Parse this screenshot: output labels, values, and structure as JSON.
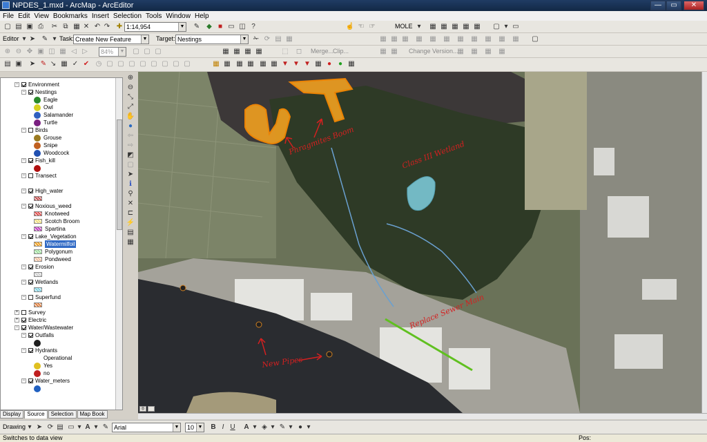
{
  "window": {
    "title": "NPDES_1.mxd - ArcMap - ArcEditor",
    "minimize": "—",
    "maximize": "▭",
    "close": "✕"
  },
  "menu": [
    "File",
    "Edit",
    "View",
    "Bookmarks",
    "Insert",
    "Selection",
    "Tools",
    "Window",
    "Help"
  ],
  "toolbar": {
    "scale_value": "1:14,954",
    "editor_label": "Editor",
    "task_label": "Task:",
    "task_value": "Create New Feature",
    "target_label": "Target:",
    "target_value": "Nestings",
    "zoom_value": "84%",
    "merge_label": "Merge...",
    "clip_label": "Clip...",
    "mole_label": "MOLE",
    "change_version_label": "Change Version..."
  },
  "toc": {
    "rows": [
      {
        "level": 1,
        "label": "Environment",
        "checked": true,
        "expand": "−"
      },
      {
        "level": 2,
        "label": "Nestings",
        "checked": true,
        "expand": "−"
      },
      {
        "level": 3,
        "label": "Eagle",
        "symbol_color": "#2a8a2a"
      },
      {
        "level": 3,
        "label": "Owl",
        "symbol_color": "#d6d020"
      },
      {
        "level": 3,
        "label": "Salamander",
        "symbol_color": "#3060c0"
      },
      {
        "level": 3,
        "label": "Turtle",
        "symbol_color": "#7a2080"
      },
      {
        "level": 2,
        "label": "Birds",
        "checked": false,
        "expand": "−"
      },
      {
        "level": 3,
        "label": "Grouse",
        "symbol_color": "#9a7a20"
      },
      {
        "level": 3,
        "label": "Snipe",
        "symbol_color": "#c06020"
      },
      {
        "level": 3,
        "label": "Woodcock",
        "symbol_color": "#2050b0"
      },
      {
        "level": 2,
        "label": "Fish_kill",
        "checked": true,
        "expand": "−"
      },
      {
        "level": 3,
        "label": "",
        "symbol_color": "#b01010"
      },
      {
        "level": 2,
        "label": "Transect",
        "checked": false,
        "expand": "−"
      },
      {
        "level": 3,
        "label": "",
        "symbol_color": ""
      },
      {
        "level": 2,
        "label": "High_water",
        "checked": true,
        "expand": "−"
      },
      {
        "level": 3,
        "label": "",
        "patch_color": "#c05050"
      },
      {
        "level": 2,
        "label": "Noxious_weed",
        "checked": true,
        "expand": "−"
      },
      {
        "level": 3,
        "label": "Knotweed",
        "patch_color": "#e05050"
      },
      {
        "level": 3,
        "label": "Scotch Broom",
        "patch_color": "#f0e080"
      },
      {
        "level": 3,
        "label": "Spartina",
        "patch_color": "#c040c0"
      },
      {
        "level": 2,
        "label": "Lake_Vegetation",
        "checked": true,
        "expand": "−"
      },
      {
        "level": 3,
        "label": "Watermilfoil",
        "patch_color": "#f0a020",
        "selected": true
      },
      {
        "level": 3,
        "label": "Polygonum",
        "patch_color": "#a0e0a0"
      },
      {
        "level": 3,
        "label": "Pondweed",
        "patch_color": "#f0c0a0"
      },
      {
        "level": 2,
        "label": "Erosion",
        "checked": true,
        "expand": "−"
      },
      {
        "level": 3,
        "label": "",
        "patch_color": "#d0d0d0"
      },
      {
        "level": 2,
        "label": "Wetlands",
        "checked": true,
        "expand": "−"
      },
      {
        "level": 3,
        "label": "",
        "patch_color": "#80d0e0"
      },
      {
        "level": 2,
        "label": "Superfund",
        "checked": false,
        "expand": "−"
      },
      {
        "level": 3,
        "label": "",
        "patch_color": "#e08040"
      },
      {
        "level": 1,
        "label": "Survey",
        "checked": false,
        "expand": "+"
      },
      {
        "level": 1,
        "label": "Electric",
        "checked": true,
        "expand": "+"
      },
      {
        "level": 1,
        "label": "Water/Wastewater",
        "checked": true,
        "expand": "−"
      },
      {
        "level": 2,
        "label": "Outfalls",
        "checked": true,
        "expand": "−"
      },
      {
        "level": 3,
        "label": "",
        "symbol_color": "#202020"
      },
      {
        "level": 2,
        "label": "Hydrants",
        "checked": true,
        "expand": "−"
      },
      {
        "level": 3,
        "label": "Operational",
        "symbol_color": ""
      },
      {
        "level": 3,
        "label": "Yes",
        "symbol_color": "#e0c020"
      },
      {
        "level": 3,
        "label": "no",
        "symbol_color": "#c02020"
      },
      {
        "level": 2,
        "label": "Water_meters",
        "checked": true,
        "expand": "−"
      },
      {
        "level": 3,
        "label": "",
        "symbol_color": "#2060c0"
      }
    ]
  },
  "tabs": [
    "Display",
    "Source",
    "Selection",
    "Map Book"
  ],
  "annotations": [
    {
      "text": "Phragmites Boom"
    },
    {
      "text": "Class III Wetland"
    },
    {
      "text": "Replace Sewer Main"
    },
    {
      "text": "New Pipes"
    }
  ],
  "drawing": {
    "label": "Drawing",
    "font_value": "Arial",
    "size_value": "10",
    "bold": "B",
    "italic": "I",
    "underline": "U"
  },
  "status": {
    "message": "Switches to data view",
    "position_label": "Pos:"
  },
  "colors": {
    "accent": "#316ac5",
    "annotation": "#d42020",
    "sewer_line": "#60c020"
  }
}
